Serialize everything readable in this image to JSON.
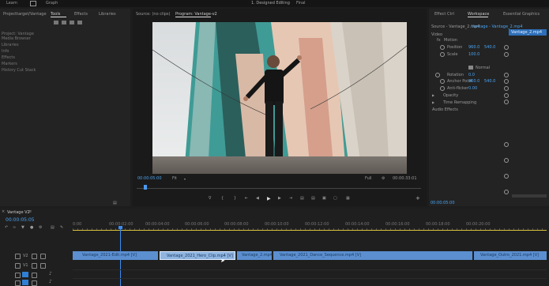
{
  "topbar": {
    "home": "Learn",
    "import": "Edit",
    "export": "Graph",
    "title": "1. Designed Editing",
    "title_suffix": "Final"
  },
  "left_panel": {
    "tabs": [
      "Projecttarget/Vantage",
      "Tools",
      "Effects",
      "Libraries"
    ],
    "items": [
      "Project: Vantage",
      "Media Browser",
      "Libraries",
      "Info",
      "Effects",
      "Markers",
      "History Cut Stack"
    ]
  },
  "program": {
    "tabs": [
      "Source: (no clips)",
      "Program: Vantage-v2"
    ],
    "timecode": "00:00:05:00",
    "fit": "Fit",
    "quality": "Full",
    "duration": "00:00:33:01",
    "ruler_left": "00:00:00",
    "ruler_right": "00:00:33:00"
  },
  "effect_controls": {
    "tabs": [
      "Effect Ctrl",
      "Workspace",
      "Essential Graphics"
    ],
    "source": "Source - Vantage_2.mp4",
    "sequence": "Vantage - Vantage_2.mp4",
    "section_video": "Video",
    "motion": "Motion",
    "position_label": "Position",
    "position_x": "960.0",
    "position_y": "540.0",
    "scale_label": "Scale",
    "scale_value": "100.0",
    "opacity_label": "Opacity",
    "blend_label": "Normal",
    "rotation_label": "Rotation",
    "rotation_value": "0.0",
    "anchor_label": "Anchor Point",
    "anchor_x": "960.0",
    "anchor_y": "540.0",
    "flicker_label": "Anti-flicker",
    "flicker_value": "0.00",
    "timeremap": "Time Remapping",
    "audio": "Audio Effects",
    "footer_time": "00:00:05:00",
    "clip_popup": "Vantage_2.mp4"
  },
  "timeline": {
    "tab": "Vantage V2",
    "timecode": "00:00:05:05",
    "ruler_labels": [
      "0:00",
      "00:00:02:00",
      "00:00:04:00",
      "00:00:06:00",
      "00:00:08:00",
      "00:00:10:00",
      "00:00:12:00",
      "00:00:14:00",
      "00:00:16:00",
      "00:00:18:00",
      "00:00:20:00"
    ],
    "tracks": [
      "V3",
      "V2",
      "V1",
      "A1"
    ],
    "clips": [
      {
        "label": "Vantage_2021-Edit.mp4 [V]"
      },
      {
        "label": "Vantage_2021_Hero_Clip.mp4 [V]"
      },
      {
        "label": "Vantage_2.mp4 [V]"
      },
      {
        "label": "Vantage_2021_Dance_Sequence.mp4 [V]"
      },
      {
        "label": "Vantage_Outro_2021.mp4 [V]"
      }
    ]
  },
  "colors": {
    "accent": "#2f7fd6",
    "clip": "#5b8fd0",
    "clip_selected": "#8fb4e0",
    "playhead": "#3d8bf0"
  }
}
